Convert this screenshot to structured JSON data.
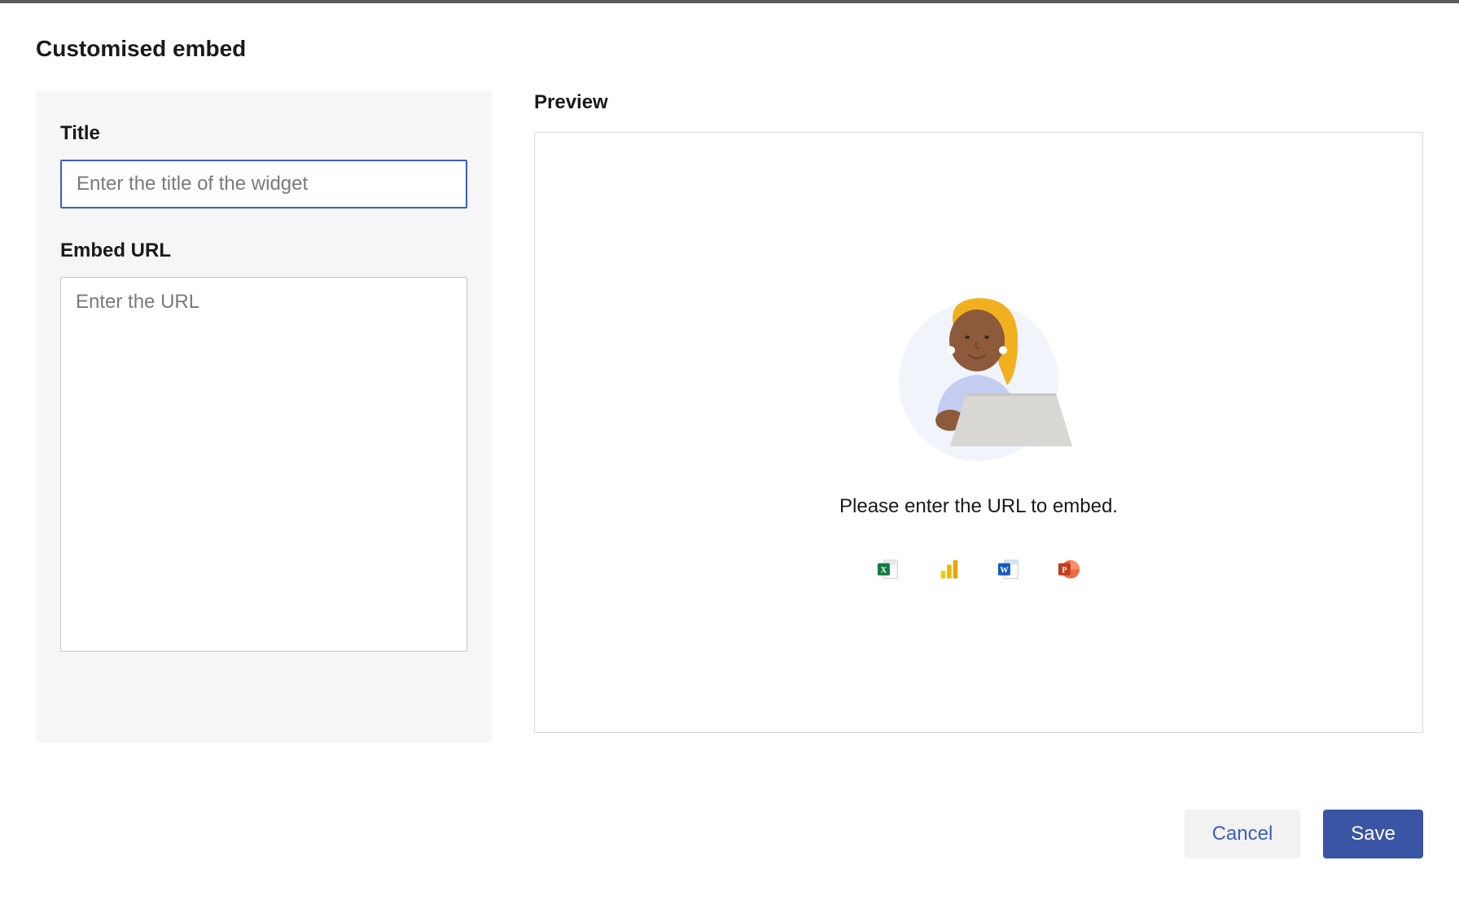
{
  "dialog": {
    "title": "Customised embed"
  },
  "form": {
    "title_label": "Title",
    "title_placeholder": "Enter the title of the widget",
    "title_value": "",
    "url_label": "Embed URL",
    "url_placeholder": "Enter the URL",
    "url_value": ""
  },
  "preview": {
    "label": "Preview",
    "message": "Please enter the URL to embed.",
    "app_icons": [
      "excel",
      "powerbi",
      "word",
      "powerpoint"
    ]
  },
  "actions": {
    "cancel_label": "Cancel",
    "save_label": "Save"
  }
}
